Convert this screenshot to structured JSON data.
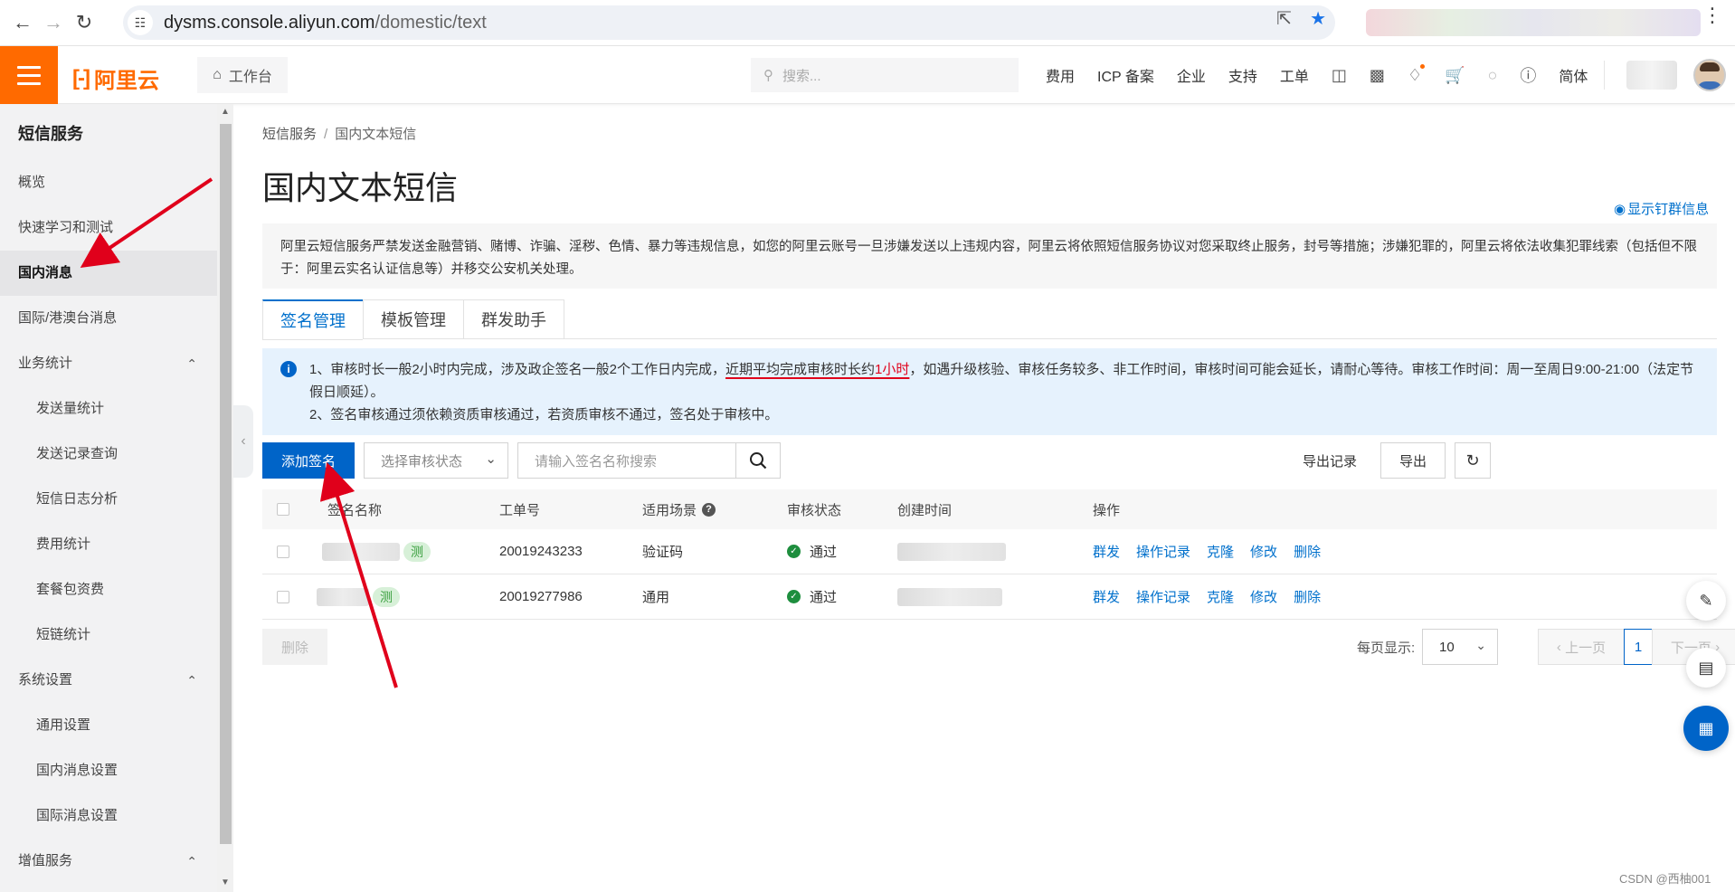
{
  "browser": {
    "url_host": "dysms.console.aliyun.com",
    "url_path": "/domestic/text"
  },
  "topbar": {
    "logo_text": "阿里云",
    "workbench": "工作台",
    "search_placeholder": "搜索...",
    "nav": [
      "费用",
      "ICP 备案",
      "企业",
      "支持",
      "工单"
    ],
    "lang": "简体"
  },
  "sidebar": {
    "title": "短信服务",
    "items": [
      {
        "label": "概览",
        "sub": false
      },
      {
        "label": "快速学习和测试",
        "sub": false
      },
      {
        "label": "国内消息",
        "sub": false,
        "active": true
      },
      {
        "label": "国际/港澳台消息",
        "sub": false
      },
      {
        "label": "业务统计",
        "sub": false,
        "group": true
      },
      {
        "label": "发送量统计",
        "sub": true
      },
      {
        "label": "发送记录查询",
        "sub": true
      },
      {
        "label": "短信日志分析",
        "sub": true
      },
      {
        "label": "费用统计",
        "sub": true
      },
      {
        "label": "套餐包资费",
        "sub": true
      },
      {
        "label": "短链统计",
        "sub": true
      },
      {
        "label": "系统设置",
        "sub": false,
        "group": true
      },
      {
        "label": "通用设置",
        "sub": true
      },
      {
        "label": "国内消息设置",
        "sub": true
      },
      {
        "label": "国际消息设置",
        "sub": true
      },
      {
        "label": "增值服务",
        "sub": false,
        "group": true
      }
    ]
  },
  "main": {
    "breadcrumb": [
      "短信服务",
      "国内文本短信"
    ],
    "title": "国内文本短信",
    "show_group_info": "显示钉群信息",
    "notice": "阿里云短信服务严禁发送金融营销、赌博、诈骗、淫秽、色情、暴力等违规信息，如您的阿里云账号一旦涉嫌发送以上违规内容，阿里云将依照短信服务协议对您采取终止服务，封号等措施；涉嫌犯罪的，阿里云将依法收集犯罪线索（包括但不限于：阿里云实名认证信息等）并移交公安机关处理。",
    "tabs": [
      "签名管理",
      "模板管理",
      "群发助手"
    ],
    "info": {
      "line1_a": "1、审核时长一般2小时内完成，涉及政企签名一般2个工作日内完成，",
      "line1_hl": "近期平均完成审核时长约",
      "line1_red": "1小时",
      "line1_b": "，如遇升级核验、审核任务较多、非工作时间，审核时间可能会延长，请耐心等待。审核工作时间：周一至周日9:00-21:00（法定节假日顺延）。",
      "line2": "2、签名审核通过须依赖资质审核通过，若资质审核不通过，签名处于审核中。"
    },
    "toolbar": {
      "add": "添加签名",
      "status_placeholder": "选择审核状态",
      "search_placeholder": "请输入签名名称搜索",
      "export_records": "导出记录",
      "export": "导出"
    },
    "table": {
      "headers": [
        "签名名称",
        "工单号",
        "适用场景",
        "审核状态",
        "创建时间",
        "操作"
      ],
      "rows": [
        {
          "tag": "测",
          "order": "20019243233",
          "scene": "验证码",
          "status": "通过"
        },
        {
          "tag": "测",
          "order": "20019277986",
          "scene": "通用",
          "status": "通过"
        }
      ],
      "ops": [
        "群发",
        "操作记录",
        "克隆",
        "修改",
        "删除"
      ]
    },
    "footer": {
      "delete": "删除",
      "per_page_label": "每页显示:",
      "per_page": "10",
      "prev": "上一页",
      "page": "1",
      "next": "下一页"
    }
  },
  "watermark": "CSDN @西柚001",
  "colors": {
    "brand": "#ff6a00",
    "primary": "#0064c8",
    "link": "#0070cc",
    "annotation": "#e0001b"
  }
}
